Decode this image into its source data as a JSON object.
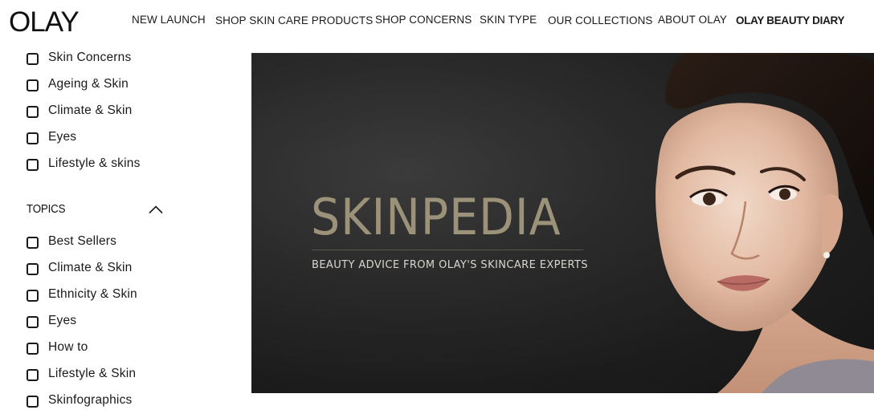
{
  "brand": {
    "logo_text": "OLAY"
  },
  "nav": {
    "items": [
      {
        "label": "NEW LAUNCH"
      },
      {
        "label": "SHOP SKIN CARE PRODUCTS"
      },
      {
        "label": "SHOP CONCERNS"
      },
      {
        "label": "SKIN TYPE"
      },
      {
        "label": "OUR COLLECTIONS"
      },
      {
        "label": "ABOUT OLAY"
      },
      {
        "label": "OLAY BEAUTY DIARY"
      }
    ]
  },
  "sidebar": {
    "first_group": [
      {
        "label": "Skin Concerns"
      },
      {
        "label": "Ageing & Skin"
      },
      {
        "label": "Climate & Skin"
      },
      {
        "label": "Eyes"
      },
      {
        "label": "Lifestyle & skins"
      }
    ],
    "topics_title": "TOPICS",
    "topics": [
      {
        "label": "Best Sellers"
      },
      {
        "label": "Climate & Skin"
      },
      {
        "label": "Ethnicity & Skin"
      },
      {
        "label": "Eyes"
      },
      {
        "label": "How to"
      },
      {
        "label": "Lifestyle & Skin"
      },
      {
        "label": "Skinfographics"
      }
    ]
  },
  "hero": {
    "title": "SKINPEDIA",
    "subtitle": "BEAUTY ADVICE FROM OLAY'S SKINCARE EXPERTS"
  },
  "colors": {
    "hero_title": "#9b9279",
    "hero_background": "#262626",
    "text": "#1a1a1a"
  },
  "icons": {
    "topics_toggle": "chevron-up-icon"
  }
}
